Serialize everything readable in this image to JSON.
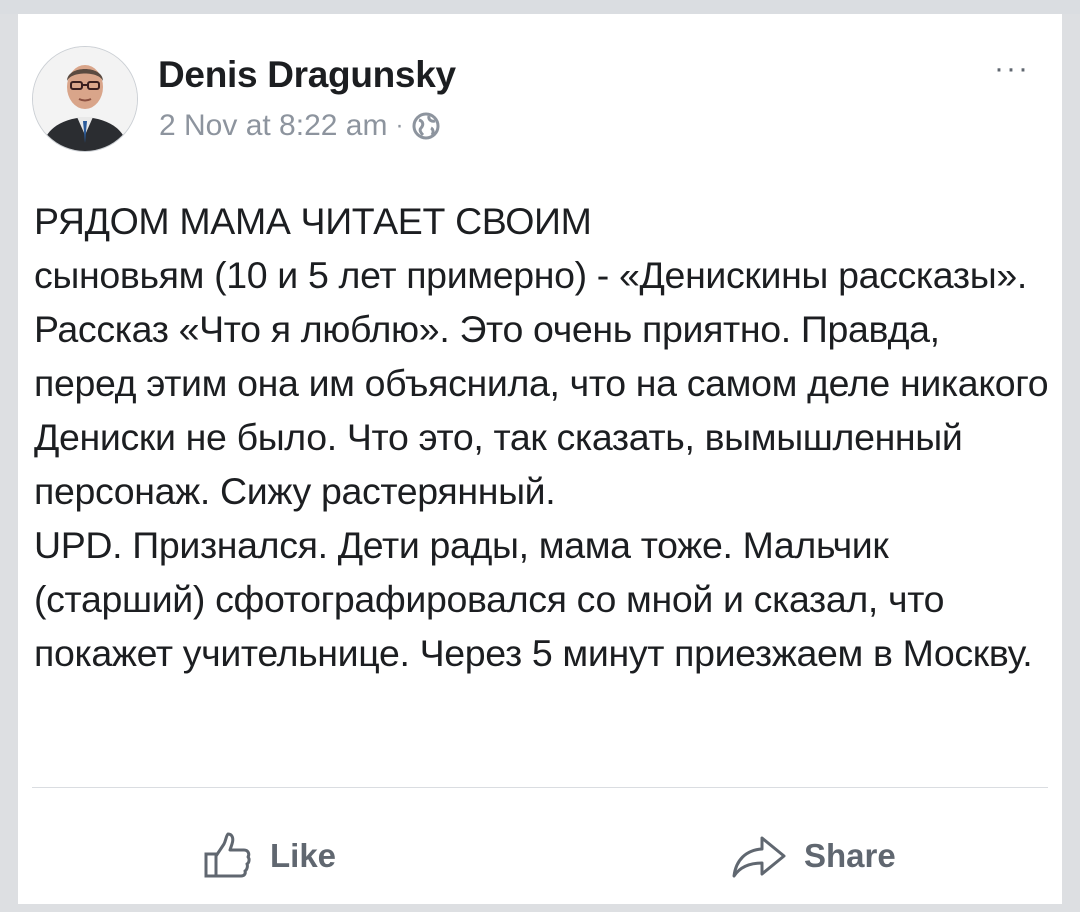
{
  "post": {
    "author": "Denis Dragunsky",
    "timestamp": "2 Nov at 8:22 am",
    "separator": "·",
    "audience_icon": "globe-icon",
    "more_label": "···",
    "paragraphs": [
      "РЯДОМ МАМА ЧИТАЕТ СВОИМ",
      "сыновьям (10 и 5 лет примерно) - «Денискины рассказы». Рассказ «Что я люблю». Это очень приятно. Правда, перед этим она им объяснила, что на самом деле никакого Дениски не было. Что это, так сказать, вымышленный персонаж. Сижу растерянный.",
      "UPD. Признался. Дети рады, мама тоже. Мальчик (старший) сфотографировался со мной и сказал, что покажет учительнице. Через 5 минут приезжаем в Москву."
    ]
  },
  "actions": {
    "like_label": "Like",
    "like_icon": "thumbs-up-icon",
    "share_label": "Share",
    "share_icon": "share-arrow-icon"
  },
  "colors": {
    "text": "#1c1e21",
    "secondary": "#8d949e",
    "action": "#606770",
    "background": "#dddfe2",
    "card": "#ffffff"
  }
}
